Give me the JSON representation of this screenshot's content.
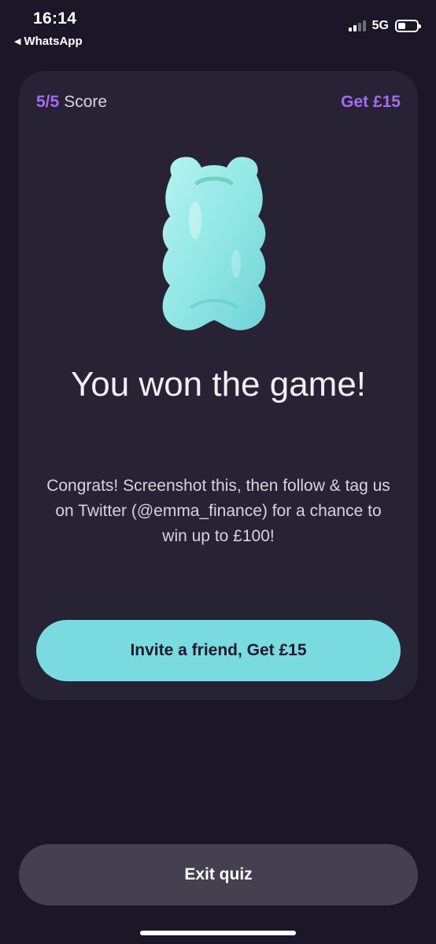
{
  "status_bar": {
    "time": "16:14",
    "back_app": "WhatsApp",
    "network": "5G",
    "icons": [
      "signal-icon",
      "battery-icon",
      "back-arrow-icon"
    ]
  },
  "quiz": {
    "score_value": "5/5",
    "score_label": "Score",
    "reward_label": "Get £15",
    "image": "gummy-bear-icon",
    "title": "You won the game!",
    "body": "Congrats! Screenshot this, then follow & tag us on Twitter (@emma_finance) for a chance to win up to  £100!",
    "invite_button": "Invite a friend, Get £15"
  },
  "exit_button": "Exit quiz",
  "colors": {
    "background": "#1b1628",
    "card": "#272234",
    "accent_purple": "#a46bf0",
    "invite_button": "#79dbe0",
    "exit_button": "#45404f",
    "bear": "#8ee6e4"
  }
}
